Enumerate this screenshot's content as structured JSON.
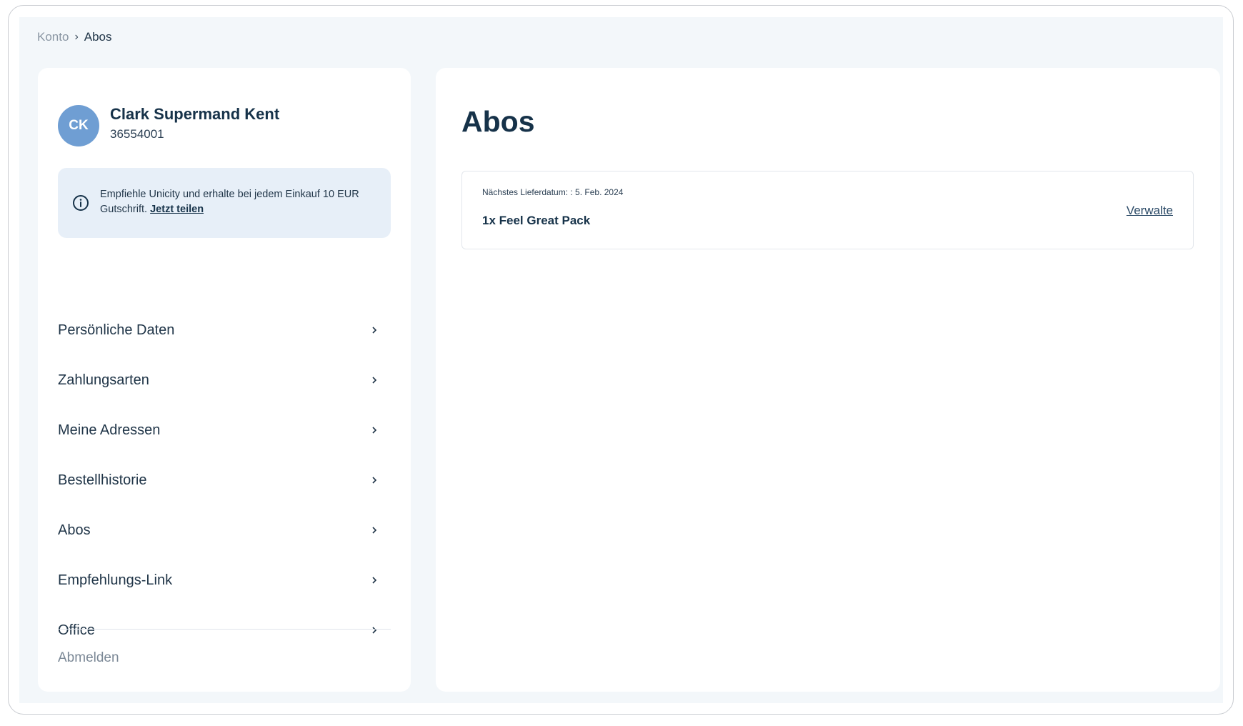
{
  "breadcrumb": {
    "parent": "Konto",
    "separator": "›",
    "current": "Abos"
  },
  "user": {
    "initials": "CK",
    "name": "Clark Supermand Kent",
    "id": "36554001"
  },
  "referral": {
    "icon": "info-icon",
    "text": "Empfiehle Unicity und erhalte bei jedem Einkauf 10 EUR Gutschrift.",
    "link_label": "Jetzt teilen"
  },
  "nav": {
    "items": [
      {
        "label": "Persönliche Daten"
      },
      {
        "label": "Zahlungsarten"
      },
      {
        "label": "Meine Adressen"
      },
      {
        "label": "Bestellhistorie"
      },
      {
        "label": "Abos"
      },
      {
        "label": "Empfehlungs-Link"
      },
      {
        "label": "Office"
      }
    ],
    "logout_label": "Abmelden"
  },
  "main": {
    "title": "Abos",
    "subscription": {
      "delivery_text": "Nächstes Lieferdatum: : 5. Feb. 2024",
      "product": "1x Feel Great Pack",
      "manage_label": "Verwalte"
    }
  },
  "colors": {
    "accent": "#163249",
    "avatar": "#6f9ed3",
    "page_bg": "#f3f7fa",
    "info_bg": "#e7eff8"
  }
}
